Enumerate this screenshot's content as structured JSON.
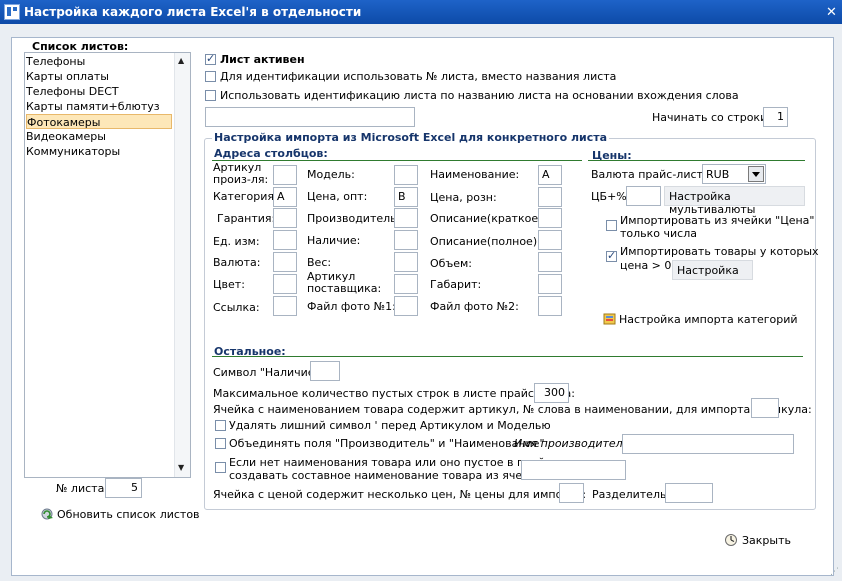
{
  "window": {
    "title": "Настройка каждого листа Excel'я в отдельности",
    "close_glyph": "✕"
  },
  "sheets": {
    "header": "Список листов:",
    "items": [
      "Телефоны",
      "Карты оплаты",
      "Телефоны DECT",
      "Карты памяти+блютуз",
      "Фотокамеры",
      "Видеокамеры",
      "Коммуникаторы"
    ],
    "selected_index": 4,
    "sheet_no_label": "№ листа:",
    "sheet_no_value": "5",
    "refresh_label": "Обновить список листов"
  },
  "top": {
    "active_label": "Лист активен",
    "use_number_label": "Для идентификации использовать № листа, вместо названия листа",
    "use_word_label": "Использовать идентификацию листа по названию листа на основании вхождения слова",
    "word_value": "",
    "start_row_label": "Начинать со строки:",
    "start_row_value": "1"
  },
  "import": {
    "group_title": "Настройка импорта из Microsoft Excel для конкретного листа",
    "columns_title": "Адреса столбцов:",
    "col1": [
      {
        "label": "Артикул произ-ля:",
        "value": ""
      },
      {
        "label": "Категория:",
        "value": "A"
      },
      {
        "label": "Гарантия:",
        "value": ""
      },
      {
        "label": "Ед. изм:",
        "value": ""
      },
      {
        "label": "Валюта:",
        "value": ""
      },
      {
        "label": "Цвет:",
        "value": ""
      },
      {
        "label": "Ссылка:",
        "value": ""
      }
    ],
    "col2": [
      {
        "label": "Модель:",
        "value": ""
      },
      {
        "label": "Цена, опт:",
        "value": "B"
      },
      {
        "label": "Производитель:",
        "value": ""
      },
      {
        "label": "Наличие:",
        "value": ""
      },
      {
        "label": "Вес:",
        "value": ""
      },
      {
        "label": "Артикул поставщика:",
        "value": ""
      },
      {
        "label": "Файл фото №1:",
        "value": ""
      }
    ],
    "col3": [
      {
        "label": "Наименование:",
        "value": "A"
      },
      {
        "label": "Цена, розн:",
        "value": ""
      },
      {
        "label": "Описание(краткое):",
        "value": ""
      },
      {
        "label": "Описание(полное):",
        "value": ""
      },
      {
        "label": "Объем:",
        "value": ""
      },
      {
        "label": "Габарит:",
        "value": ""
      },
      {
        "label": "Файл фото №2:",
        "value": ""
      }
    ],
    "prices": {
      "title": "Цены:",
      "currency_label": "Валюта прайс-листа:",
      "currency_value": "RUB",
      "cb_label": "ЦБ+%",
      "cb_value": "",
      "multicurrency_btn": "Настройка мультивалюты",
      "import_cell_line1": "Импортировать из ячейки \"Цена\"",
      "import_cell_line2": "только числа",
      "import_goods_line1": "Импортировать товары у которых",
      "import_goods_line2": "цена > 0",
      "settings_btn": "Настройка",
      "category_import_label": "Настройка импорта категорий"
    },
    "other": {
      "title": "Остальное:",
      "symbol_label": "Символ \"Наличие\":",
      "symbol_value": "",
      "max_empty_label": "Максимальное количество пустых строк в листе прайс-листа:",
      "max_empty_value": "300",
      "article_in_name_label": "Ячейка с наименованием товара содержит артикул, № слова в наименовании, для импорта артикула:",
      "article_in_name_value": "",
      "remove_quote_label": "Удалять лишний символ ' перед Артикулом и Моделью",
      "merge_label": "Объединять поля \"Производитель\" и \"Наименование\"",
      "maker_name_label": "Имя производителя:",
      "maker_name_value": "",
      "compose_line1": "Если нет наименования товара или оно пустое в прайсе,",
      "compose_line2": "создавать составное наименование товара из ячеек:",
      "compose_value": "",
      "multi_price_label": "Ячейка с ценой содержит несколько цен, № цены для импорта:",
      "multi_price_value": "",
      "separator_label": "Разделитель:",
      "separator_value": ""
    }
  },
  "footer": {
    "close_label": "Закрыть"
  }
}
